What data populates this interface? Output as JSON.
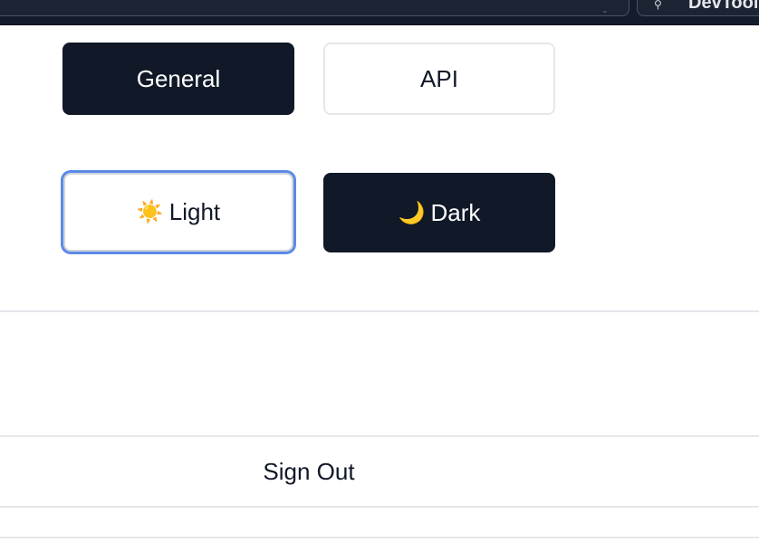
{
  "topbar": {
    "devtools_label": "DevTools",
    "chevron_icon": "chevron-down-icon",
    "wrench_icon": "wrench-icon"
  },
  "tabs": {
    "general_label": "General",
    "api_label": "API",
    "active": "General"
  },
  "theme": {
    "light_emoji": "☀️",
    "light_label": "Light",
    "dark_emoji": "🌙",
    "dark_label": "Dark",
    "selected": "Dark",
    "focused": "Light"
  },
  "account": {
    "sign_out_label": "Sign Out"
  },
  "colors": {
    "dark_button": "#111827",
    "focus_ring": "#5b8ae6",
    "divider": "#e5e7eb",
    "topbar": "#141b2b"
  }
}
